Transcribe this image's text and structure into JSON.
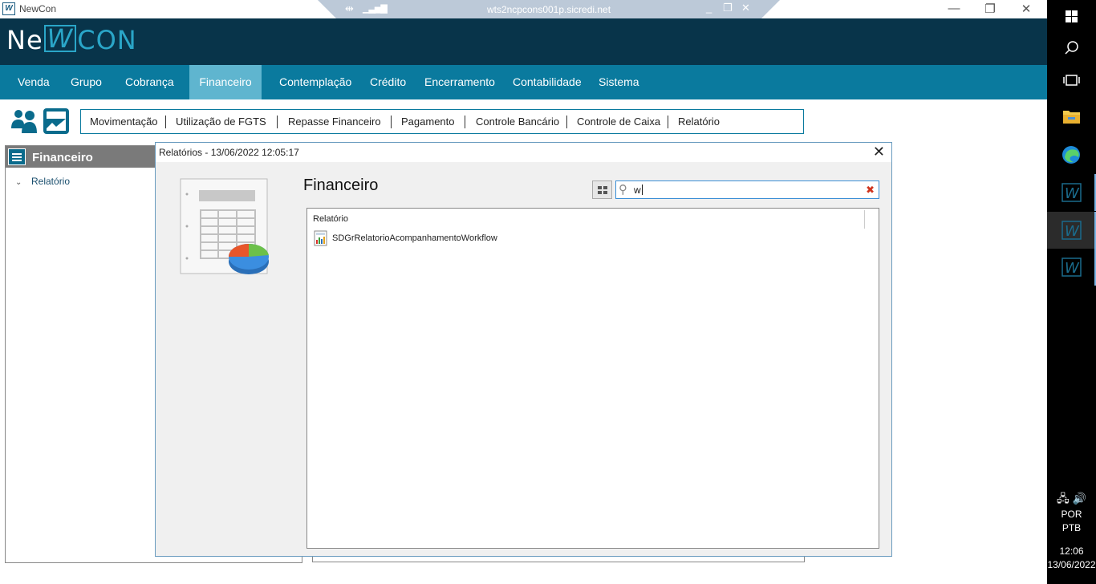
{
  "window": {
    "app_title": "NewCon",
    "rdp_host": "wts2ncpcons001p.sicredi.net",
    "minimize_glyph": "—",
    "restore_glyph": "❐",
    "close_glyph": "✕",
    "rdp_pin_glyph": "⇹",
    "rdp_signal_glyph": "▁▃▅▇",
    "rdp_minimize_glyph": "_",
    "rdp_restore_glyph": "❐",
    "rdp_close_glyph": "✕"
  },
  "brand": {
    "part1": "Ne",
    "part2": "W",
    "part3": "CON"
  },
  "nav": {
    "items": [
      "Venda",
      "Grupo",
      "Cobrança",
      "Financeiro",
      "Contemplação",
      "Crédito",
      "Encerramento",
      "Contabilidade",
      "Sistema"
    ],
    "active": "Financeiro"
  },
  "subnav": {
    "items": [
      "Movimentação",
      "Utilização de FGTS",
      "Repasse Financeiro",
      "Pagamento",
      "Controle Bancário",
      "Controle de Caixa",
      "Relatório"
    ]
  },
  "left_panel": {
    "title": "Financeiro",
    "tree": [
      {
        "label": "Relatório",
        "expanded": true
      }
    ],
    "chevron_glyph": "⌄"
  },
  "dialog": {
    "title": "Relatórios - 13/06/2022  12:05:17",
    "close_glyph": "✕",
    "heading": "Financeiro",
    "search": {
      "value": "w",
      "search_glyph": "⚲",
      "clear_glyph": "✖"
    },
    "list": {
      "column_header": "Relatório",
      "items": [
        "SDGrRelatorioAcompanhamentoWorkflow"
      ]
    }
  },
  "taskbar": {
    "language_1": "POR",
    "language_2": "PTB",
    "time": "12:06",
    "date": "13/06/2022",
    "network_glyph": "🖧",
    "volume_glyph": "🔊",
    "app_glyph": "W"
  },
  "colors": {
    "header_bg": "#08344a",
    "nav_bg": "#0a7a9e",
    "nav_active": "#5fb5cf",
    "accent": "#2aa6c8"
  }
}
